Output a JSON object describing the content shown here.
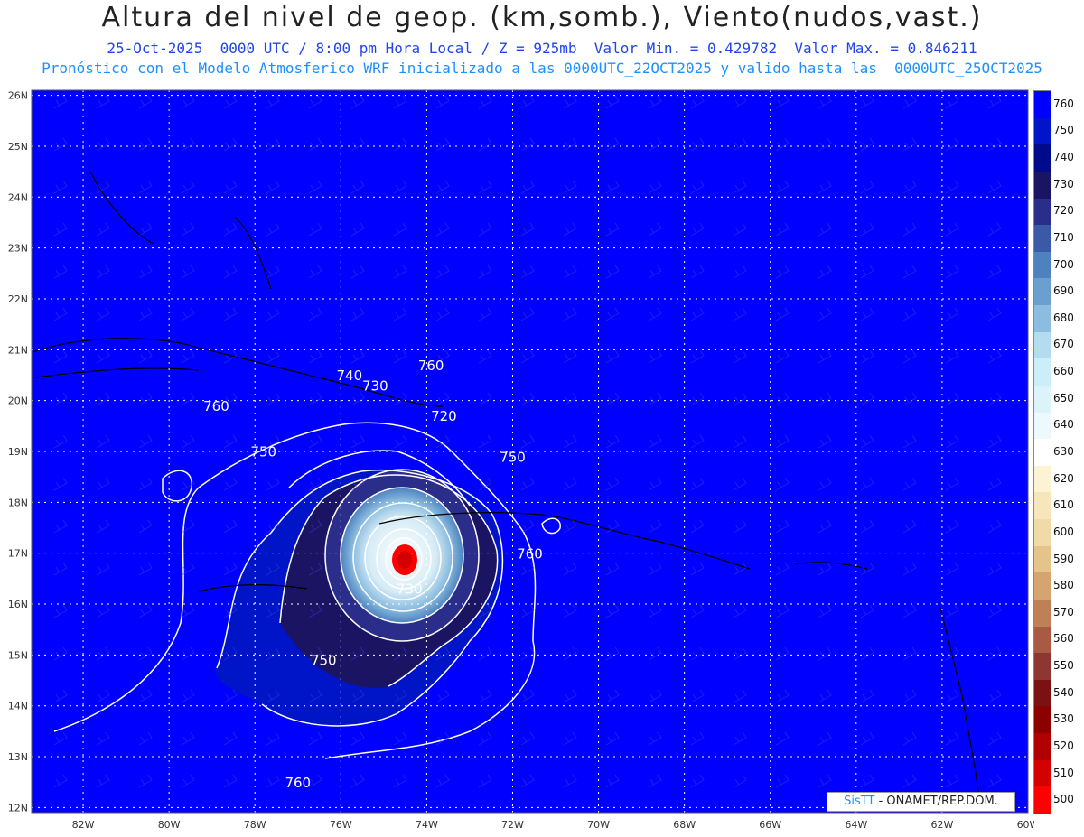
{
  "header": {
    "title": "Altura del nivel de geop. (km,somb.), Viento(nudos,vast.)",
    "subtitle1": "25-Oct-2025  0000 UTC / 8:00 pm Hora Local / Z = 925mb  Valor Min. = 0.429782  Valor Max. = 0.846211",
    "subtitle2": "Pronóstico con el Modelo Atmosferico WRF inicializado a las 0000UTC_22OCT2025 y valido hasta las  0000UTC_25OCT2025"
  },
  "map": {
    "lat_labels": [
      "26N",
      "25N",
      "24N",
      "23N",
      "22N",
      "21N",
      "20N",
      "19N",
      "18N",
      "17N",
      "16N",
      "15N",
      "14N",
      "13N",
      "12N"
    ],
    "lon_labels": [
      "82W",
      "80W",
      "78W",
      "76W",
      "74W",
      "72W",
      "70W",
      "68W",
      "66W",
      "64W",
      "62W",
      "60W"
    ],
    "ocean_color": "#0000ff",
    "contour_labels": [
      {
        "text": "760",
        "lon": -73.9,
        "lat": 20.6
      },
      {
        "text": "760",
        "lon": -78.9,
        "lat": 19.8
      },
      {
        "text": "740",
        "lon": -75.8,
        "lat": 20.4
      },
      {
        "text": "730",
        "lon": -75.2,
        "lat": 20.2
      },
      {
        "text": "720",
        "lon": -73.6,
        "lat": 19.6
      },
      {
        "text": "750",
        "lon": -77.8,
        "lat": 18.9
      },
      {
        "text": "750",
        "lon": -72.0,
        "lat": 18.8
      },
      {
        "text": "760",
        "lon": -71.6,
        "lat": 16.9
      },
      {
        "text": "730",
        "lon": -74.4,
        "lat": 16.2
      },
      {
        "text": "750",
        "lon": -76.4,
        "lat": 14.8
      },
      {
        "text": "760",
        "lon": -77.0,
        "lat": 12.4
      }
    ]
  },
  "colorbar": {
    "levels": [
      "760",
      "750",
      "740",
      "730",
      "720",
      "710",
      "700",
      "690",
      "680",
      "670",
      "660",
      "650",
      "640",
      "630",
      "620",
      "610",
      "600",
      "590",
      "580",
      "570",
      "560",
      "550",
      "540",
      "530",
      "520",
      "510",
      "500"
    ],
    "colors": [
      "#0000ff",
      "#0014c8",
      "#000a8c",
      "#1a1463",
      "#2b2d8a",
      "#3a5aa8",
      "#4e82bf",
      "#6b9fd0",
      "#8cbde0",
      "#b4dcef",
      "#cceef8",
      "#ddf3fa",
      "#ecfafd",
      "#ffffff",
      "#fbf3d2",
      "#f5e6bc",
      "#efdaa8",
      "#e5c48a",
      "#d6a56f",
      "#c08057",
      "#a85a42",
      "#8e3630",
      "#7a1214",
      "#8c0000",
      "#b00000",
      "#d40000",
      "#ff0000"
    ]
  },
  "credit": {
    "brand": "SisTT",
    "text": " - ONAMET/REP.DOM."
  }
}
